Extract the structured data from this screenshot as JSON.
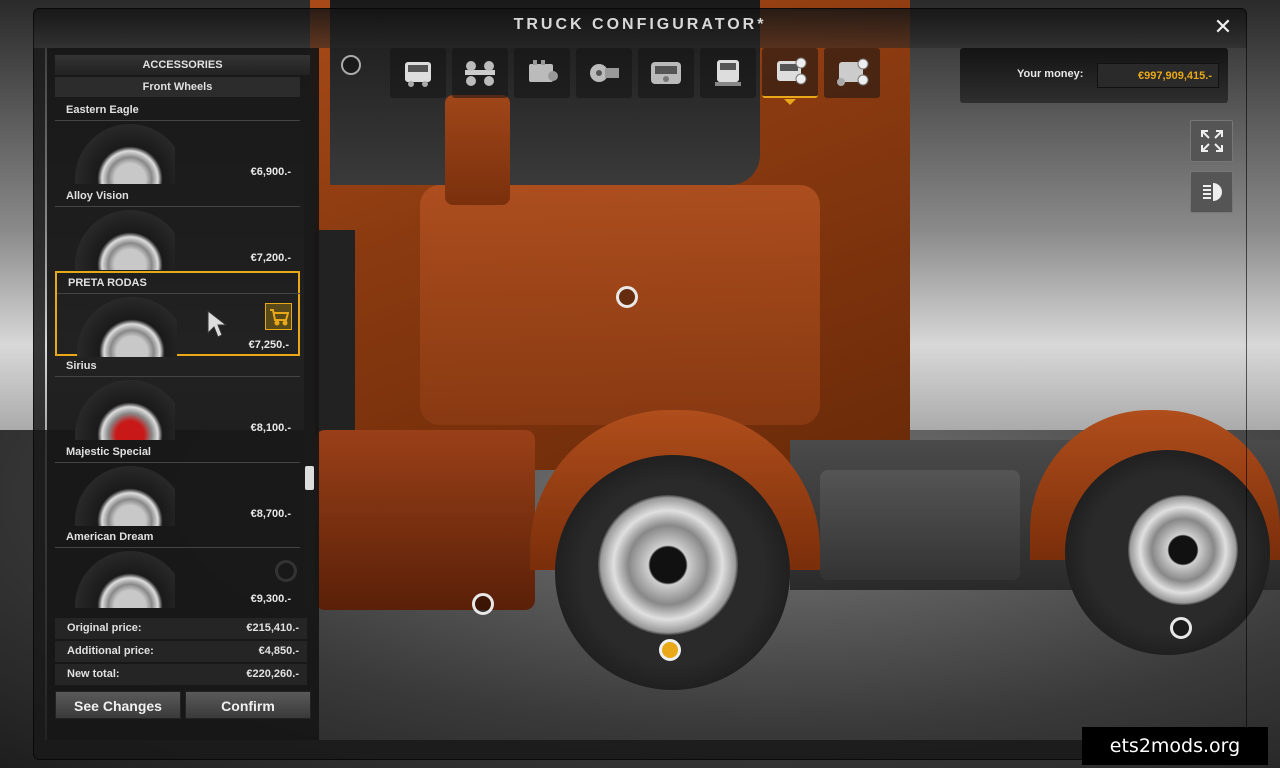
{
  "window": {
    "title": "TRUCK CONFIGURATOR*"
  },
  "categories": [
    {
      "name": "cab",
      "active": false
    },
    {
      "name": "chassis",
      "active": false
    },
    {
      "name": "engine",
      "active": false
    },
    {
      "name": "transmission",
      "active": false
    },
    {
      "name": "interior",
      "active": false
    },
    {
      "name": "paint",
      "active": false
    },
    {
      "name": "accessories",
      "active": true
    },
    {
      "name": "accessories-2",
      "active": false
    }
  ],
  "money": {
    "label": "Your money:",
    "value": "€997,909,415.-"
  },
  "panel": {
    "header": "ACCESSORIES",
    "subheader": "Front Wheels",
    "items": [
      {
        "name": "Eastern Eagle",
        "price": "€6,900.-"
      },
      {
        "name": "Alloy Vision",
        "price": "€7,200.-"
      },
      {
        "name": "PRETA  RODAS",
        "price": "€7,250.-",
        "selected": true
      },
      {
        "name": "Sirius",
        "price": "€8,100.-"
      },
      {
        "name": "Majestic Special",
        "price": "€8,700.-"
      },
      {
        "name": "American Dream",
        "price": "€9,300.-"
      }
    ],
    "original_price_label": "Original price:",
    "original_price": "€215,410.-",
    "additional_price_label": "Additional price:",
    "additional_price": "€4,850.-",
    "new_total_label": "New total:",
    "new_total": "€220,260.-",
    "see_changes_label": "See Changes",
    "confirm_label": "Confirm"
  },
  "watermark": "ets2mods.org",
  "colors": {
    "accent": "#e8a818",
    "panel_bg": "#161616"
  }
}
